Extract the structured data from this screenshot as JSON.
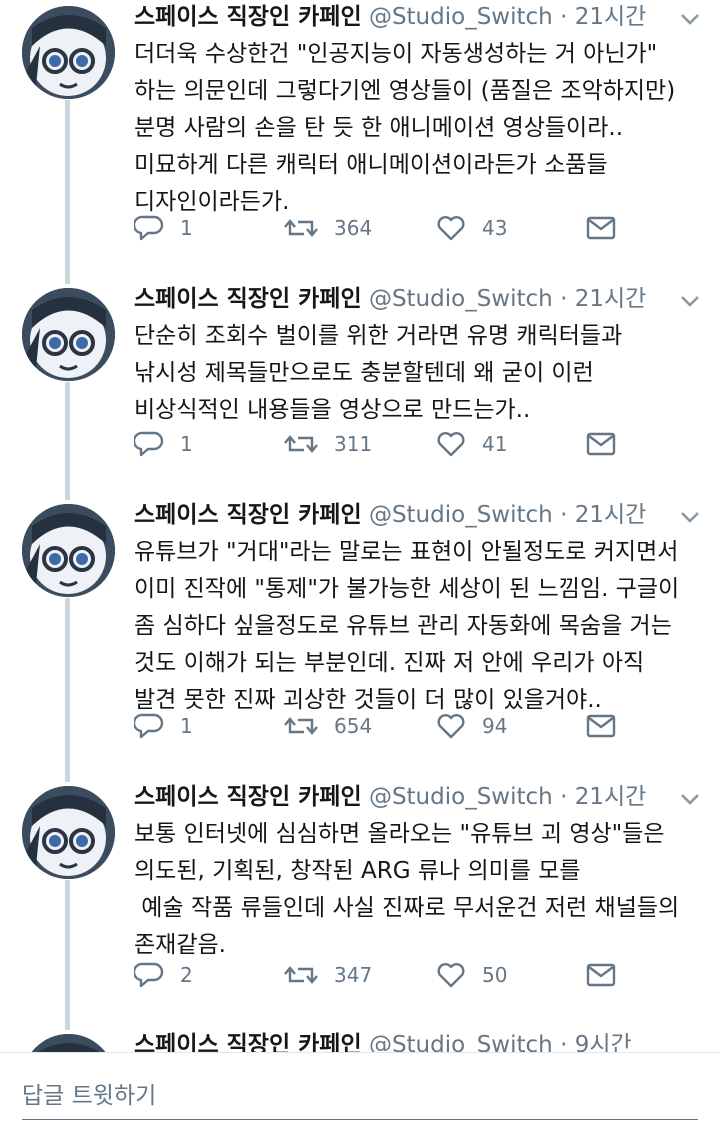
{
  "tweets": [
    {
      "name": "스페이스 직장인 카페인",
      "handle": "@Studio_Switch",
      "time": "21시간",
      "lines": [
        "더더욱 수상한건 \"인공지능이 자동생성하는 거 아닌가\"",
        "하는 의문인데 그렇다기엔 영상들이 (품질은 조악하지만)",
        "분명 사람의 손을 탄 듯 한 애니메이션 영상들이라..",
        "미묘하게 다른 캐릭터 애니메이션이라든가 소품들",
        "디자인이라든가."
      ],
      "replies": "1",
      "retweets": "364",
      "likes": "43"
    },
    {
      "name": "스페이스 직장인 카페인",
      "handle": "@Studio_Switch",
      "time": "21시간",
      "lines": [
        "단순히 조회수 벌이를 위한 거라면 유명 캐릭터들과",
        "낚시성 제목들만으로도 충분할텐데 왜 굳이 이런",
        "비상식적인 내용들을 영상으로 만드는가.."
      ],
      "replies": "1",
      "retweets": "311",
      "likes": "41"
    },
    {
      "name": "스페이스 직장인 카페인",
      "handle": "@Studio_Switch",
      "time": "21시간",
      "lines": [
        "유튜브가 \"거대\"라는 말로는 표현이 안될정도로 커지면서",
        "이미 진작에 \"통제\"가 불가능한 세상이 된 느낌임. 구글이",
        "좀 심하다 싶을정도로 유튜브 관리 자동화에 목숨을 거는",
        "것도 이해가 되는 부분인데. 진짜 저 안에 우리가 아직",
        "발견 못한 진짜 괴상한 것들이 더 많이 있을거야.."
      ],
      "replies": "1",
      "retweets": "654",
      "likes": "94"
    },
    {
      "name": "스페이스 직장인 카페인",
      "handle": "@Studio_Switch",
      "time": "21시간",
      "lines": [
        "보통 인터넷에 심심하면 올라오는 \"유튜브 괴 영상\"들은",
        "의도된, 기획된, 창작된 ARG 류나 의미를 모를",
        " 예술 작품 류들인데 사실 진짜로 무서운건 저런 채널들의",
        "존재같음."
      ],
      "replies": "2",
      "retweets": "347",
      "likes": "50"
    }
  ],
  "partial_tweet": {
    "name": "스페이스 직장인 카페인",
    "handle": "@Studio_Switch",
    "time": "9시간"
  },
  "separator": "·",
  "icons": {
    "reply": "reply-icon",
    "retweet": "retweet-icon",
    "like": "heart-icon",
    "dm": "envelope-icon",
    "caret": "chevron-down-icon"
  },
  "reply_bar": {
    "placeholder": "답글 트윗하기"
  },
  "colors": {
    "text": "#14171a",
    "secondary": "#657786",
    "thread_line": "#ccd6dd"
  }
}
